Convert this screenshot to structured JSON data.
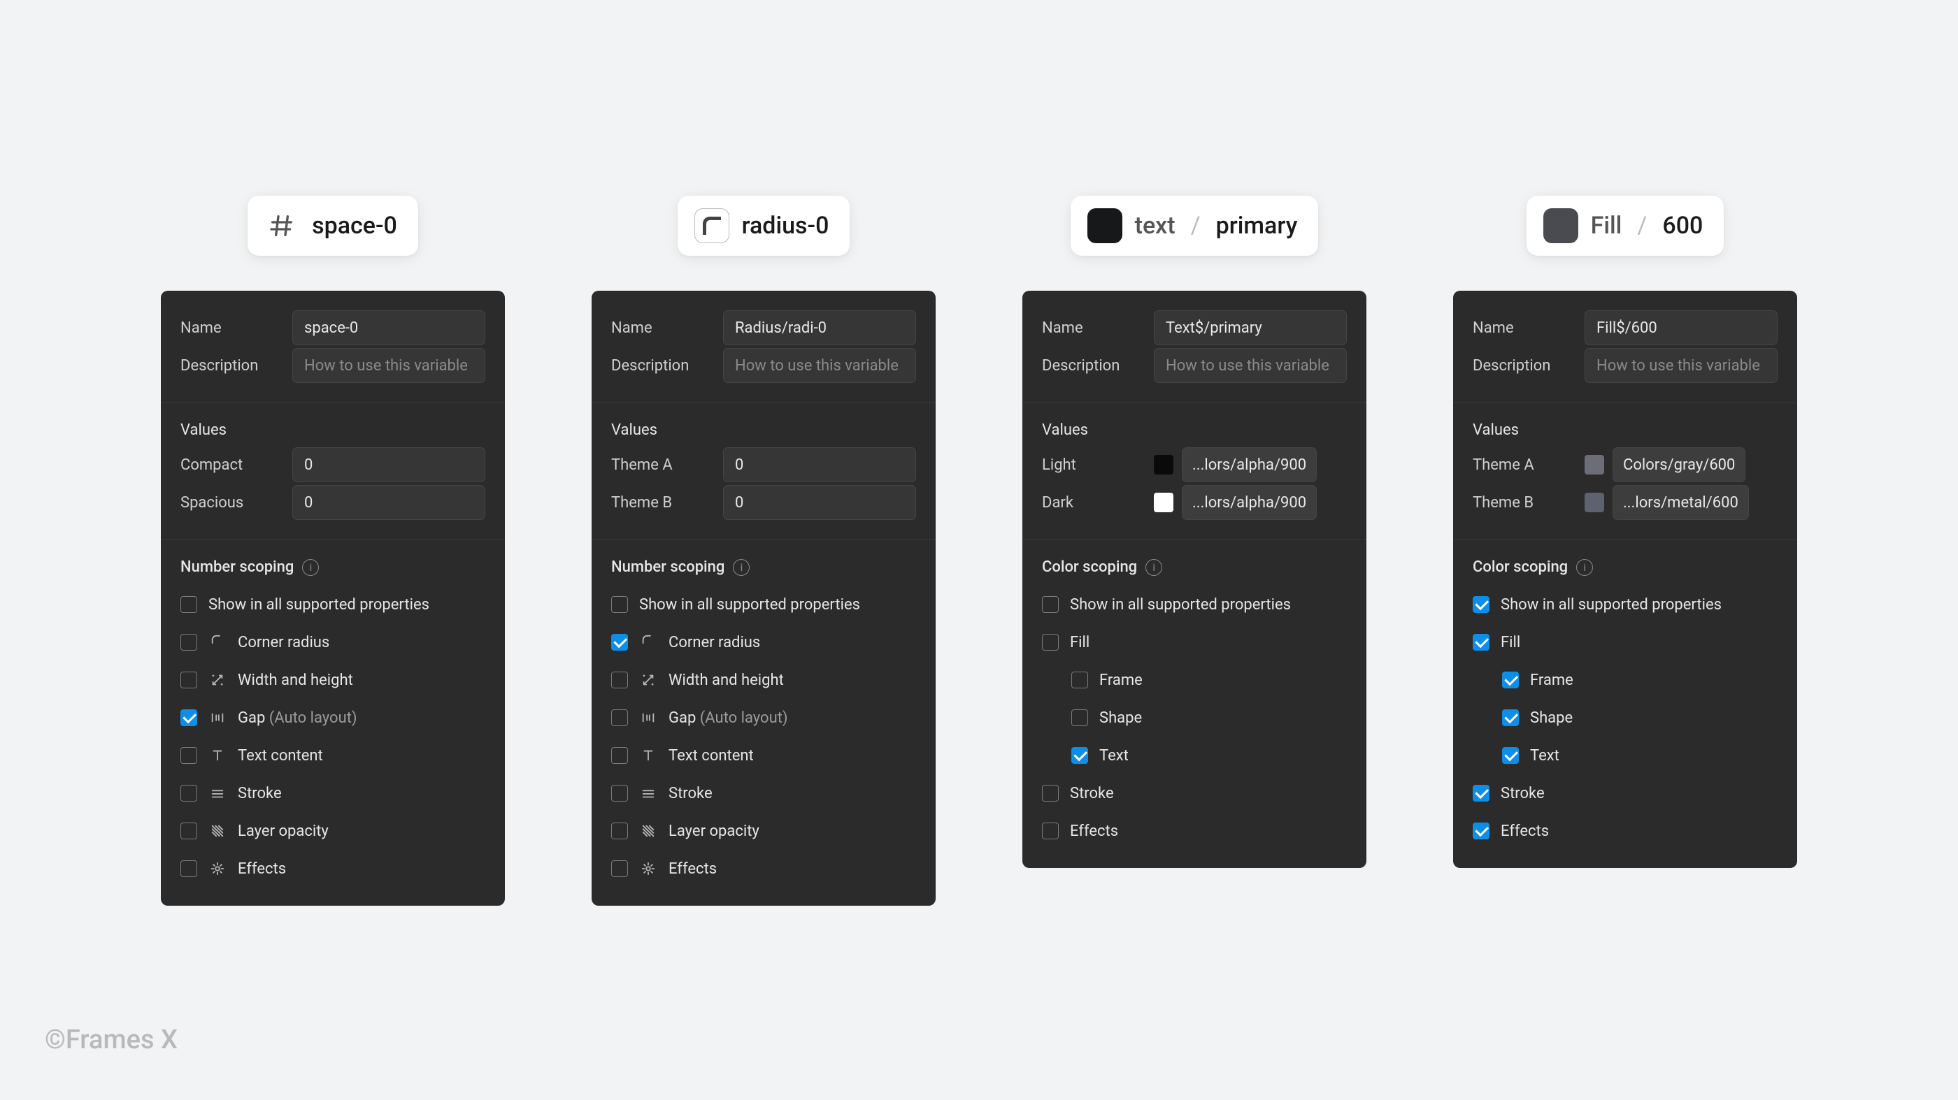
{
  "credit": "©Frames X",
  "common": {
    "description_placeholder": "How to use this variable",
    "show_all": "Show in all supported properties",
    "name_label": "Name",
    "description_label": "Description",
    "values_label": "Values",
    "number_scoping_label": "Number scoping",
    "color_scoping_label": "Color scoping"
  },
  "scope_labels": {
    "corner_radius": "Corner radius",
    "width_height": "Width and height",
    "gap": "Gap",
    "gap_suffix": "(Auto layout)",
    "text_content": "Text content",
    "stroke": "Stroke",
    "layer_opacity": "Layer opacity",
    "effects": "Effects",
    "fill": "Fill",
    "frame": "Frame",
    "shape": "Shape",
    "text": "Text"
  },
  "panels": [
    {
      "id": "space0",
      "chip_kind": "hash",
      "chip_parts": [
        "space-0"
      ],
      "name_value": "space-0",
      "values": [
        {
          "label": "Compact",
          "value": "0"
        },
        {
          "label": "Spacious",
          "value": "0"
        }
      ],
      "scoping_type": "number",
      "show_all": false,
      "opts": {
        "corner_radius": false,
        "width_height": false,
        "gap": true,
        "text_content": false,
        "stroke": false,
        "layer_opacity": false,
        "effects": false
      }
    },
    {
      "id": "radius0",
      "chip_kind": "radius",
      "chip_parts": [
        "radius-0"
      ],
      "name_value": "Radius/radi-0",
      "values": [
        {
          "label": "Theme A",
          "value": "0"
        },
        {
          "label": "Theme B",
          "value": "0"
        }
      ],
      "scoping_type": "number",
      "show_all": false,
      "opts": {
        "corner_radius": true,
        "width_height": false,
        "gap": false,
        "text_content": false,
        "stroke": false,
        "layer_opacity": false,
        "effects": false
      }
    },
    {
      "id": "textprimary",
      "chip_kind": "color",
      "chip_color": "#17181a",
      "chip_parts": [
        "text",
        "primary"
      ],
      "name_value": "Text$/primary",
      "values": [
        {
          "label": "Light",
          "swatch": "#0a0a0a",
          "alias": "...lors/alpha/900"
        },
        {
          "label": "Dark",
          "swatch": "#ffffff",
          "alias": "...lors/alpha/900"
        }
      ],
      "scoping_type": "color",
      "show_all": false,
      "opts": {
        "fill": false,
        "frame": false,
        "shape": false,
        "text": true,
        "stroke": false,
        "effects": false
      }
    },
    {
      "id": "fill600",
      "chip_kind": "color",
      "chip_color": "#4a4b51",
      "chip_parts": [
        "Fill",
        "600"
      ],
      "name_value": "Fill$/600",
      "values": [
        {
          "label": "Theme A",
          "swatch": "#6b6e76",
          "alias": "Colors/gray/600"
        },
        {
          "label": "Theme B",
          "swatch": "#5d6170",
          "alias": "...lors/metal/600"
        }
      ],
      "scoping_type": "color",
      "show_all": true,
      "opts": {
        "fill": true,
        "frame": true,
        "shape": true,
        "text": true,
        "stroke": true,
        "effects": true
      }
    }
  ]
}
